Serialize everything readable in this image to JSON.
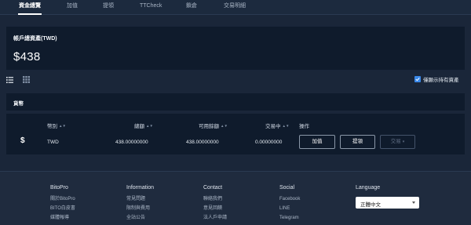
{
  "nav": {
    "tabs": [
      {
        "label": "資金總覽",
        "active": true
      },
      {
        "label": "加值",
        "active": false
      },
      {
        "label": "提領",
        "active": false
      },
      {
        "label": "TTCheck",
        "active": false
      },
      {
        "label": "鎖倉",
        "active": false
      },
      {
        "label": "交易明細",
        "active": false
      }
    ]
  },
  "account": {
    "label": "帳戶總資產(TWD)",
    "total": "$438"
  },
  "view": {
    "list_icon": "list-view-icon",
    "grid_icon": "grid-view-icon",
    "holdings_only_label": "僅顯示持有資產",
    "holdings_only_checked": true
  },
  "currency": {
    "title": "貨幣",
    "columns": {
      "currency": "幣別",
      "total": "總額",
      "available": "可用餘額",
      "in_trade": "交易中",
      "actions": "操作"
    },
    "rows": [
      {
        "icon": "$",
        "currency": "TWD",
        "total": "438.00000000",
        "available": "438.00000000",
        "in_trade": "0.00000000",
        "deposit_label": "加值",
        "withdraw_label": "提領",
        "trade_label": "交易",
        "trade_disabled": true
      }
    ]
  },
  "footer": {
    "bitopro": {
      "title": "BitoPro",
      "links": [
        "關於BitoPro",
        "BITO白皮書",
        "媒體報導"
      ]
    },
    "information": {
      "title": "Information",
      "links": [
        "常見問題",
        "限制與費用",
        "全站公告"
      ]
    },
    "contact": {
      "title": "Contact",
      "links": [
        "聯絡我們",
        "意見回饋",
        "法人戶申請"
      ]
    },
    "social": {
      "title": "Social",
      "links": [
        "Facebook",
        "LINE",
        "Telegram"
      ]
    },
    "language": {
      "title": "Language",
      "selected": "正體中文"
    }
  },
  "colors": {
    "background": "#1a2639",
    "card": "#0f1b2c",
    "accent": "#3a88e8",
    "footer": "#1f2b3e"
  }
}
